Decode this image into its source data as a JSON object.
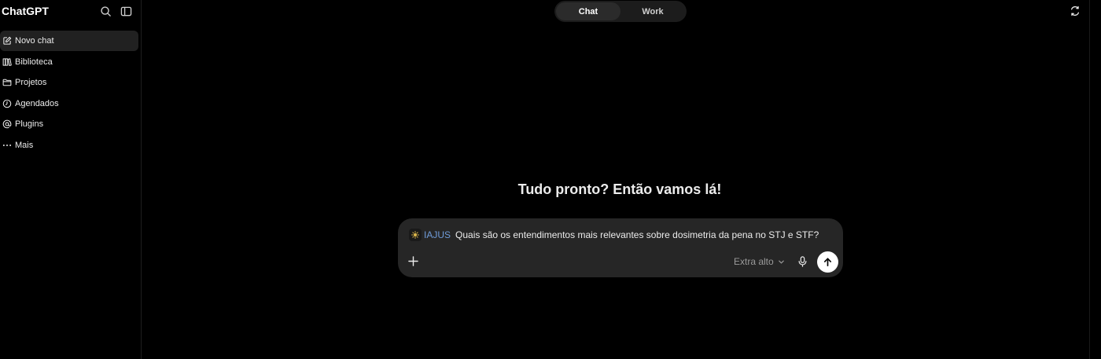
{
  "app": {
    "title": "ChatGPT"
  },
  "sidebar": {
    "items": [
      {
        "label": "Novo chat",
        "icon": "edit-icon"
      },
      {
        "label": "Biblioteca",
        "icon": "library-icon"
      },
      {
        "label": "Projetos",
        "icon": "folder-icon"
      },
      {
        "label": "Agendados",
        "icon": "clock-icon"
      },
      {
        "label": "Plugins",
        "icon": "at-icon"
      },
      {
        "label": "Mais",
        "icon": "more-icon"
      }
    ]
  },
  "mode_toggle": {
    "chat_label": "Chat",
    "work_label": "Work",
    "active": "Chat"
  },
  "main": {
    "headline": "Tudo pronto? Então vamos lá!"
  },
  "composer": {
    "plugin_name": "IAJUS",
    "prompt_text": "Quais são os entendimentos mais relevantes sobre dosimetria da pena no STJ e STF?",
    "model_label": "Extra alto"
  },
  "colors": {
    "background": "#000000",
    "composer_bg": "#262626",
    "plugin_accent": "#6f9bd8",
    "send_button": "#ffffff"
  }
}
